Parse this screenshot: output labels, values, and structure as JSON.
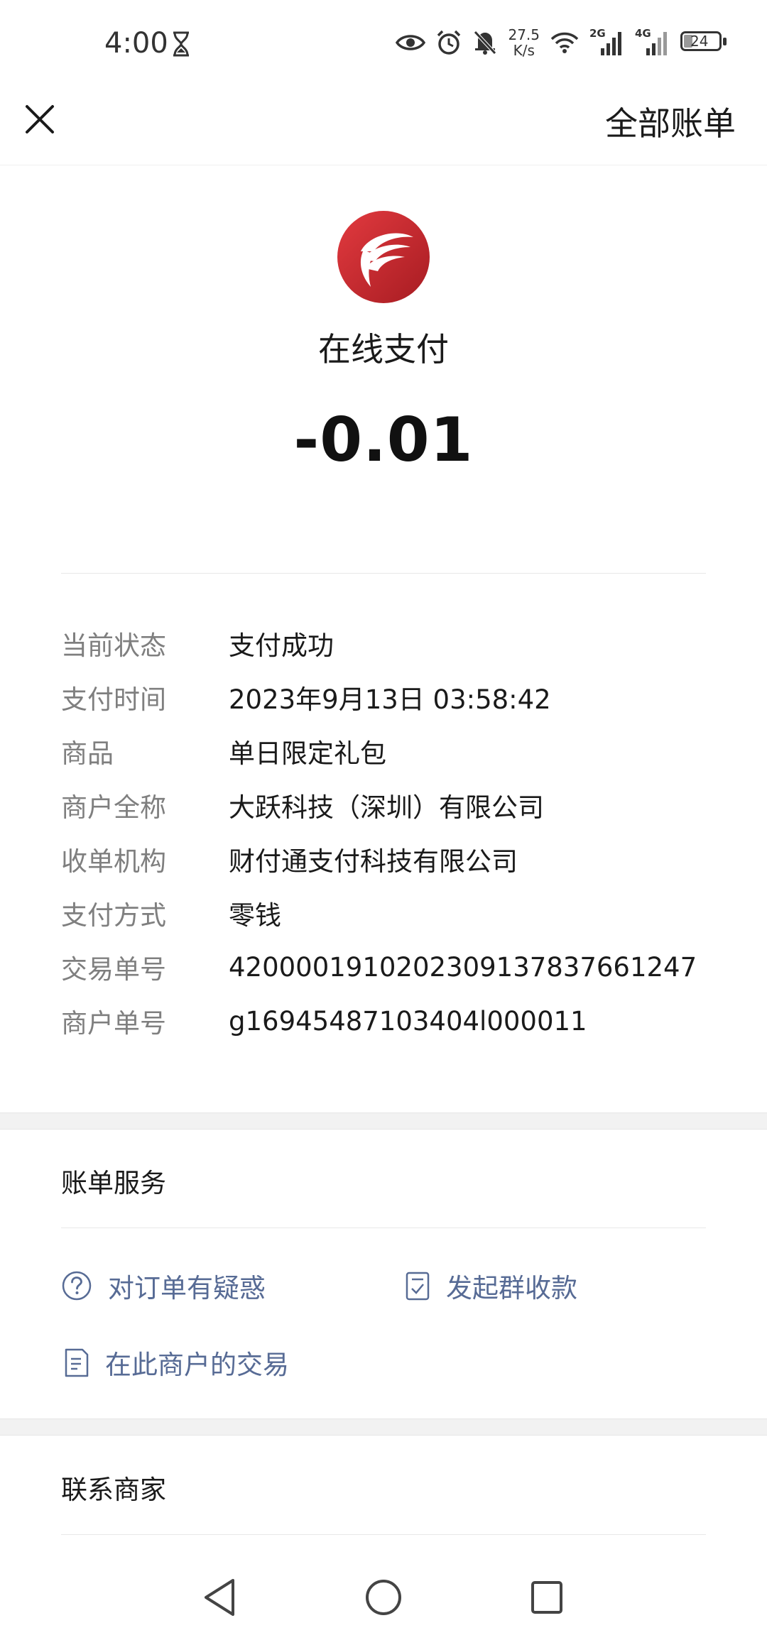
{
  "status_bar": {
    "time": "4:00",
    "net_speed_value": "27.5",
    "net_speed_unit": "K/s",
    "sim1_label": "2G",
    "sim2_label": "4G",
    "battery": "24",
    "icons": [
      "hourglass-icon",
      "eye-icon",
      "alarm-icon",
      "bell-mute-icon",
      "wifi-icon",
      "signal-icon",
      "battery-icon"
    ]
  },
  "top_nav": {
    "all_bills_label": "全部账单"
  },
  "header": {
    "merchant_name": "在线支付",
    "amount": "-0.01",
    "brand_color": "#c8252c"
  },
  "details": {
    "rows": [
      {
        "label": "当前状态",
        "value": "支付成功"
      },
      {
        "label": "支付时间",
        "value": "2023年9月13日 03:58:42"
      },
      {
        "label": "商品",
        "value": "单日限定礼包"
      },
      {
        "label": "商户全称",
        "value": "大跃科技（深圳）有限公司"
      },
      {
        "label": "收单机构",
        "value": "财付通支付科技有限公司"
      },
      {
        "label": "支付方式",
        "value": "零钱"
      },
      {
        "label": "交易单号",
        "value": "4200001910202309137837661247"
      },
      {
        "label": "商户单号",
        "value": "g16945487103404l000011"
      }
    ]
  },
  "bill_service": {
    "title": "账单服务",
    "links": {
      "question": "对订单有疑惑",
      "group_collect": "发起群收款",
      "merchant_transactions": "在此商户的交易"
    },
    "link_color": "#576b95"
  },
  "contact": {
    "title": "联系商家"
  }
}
